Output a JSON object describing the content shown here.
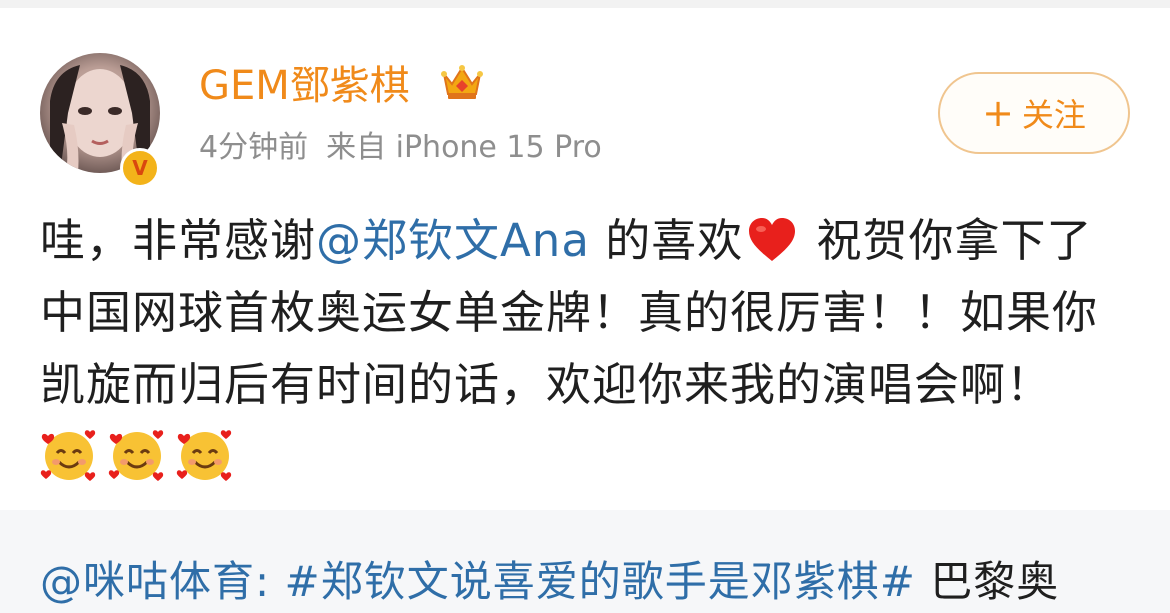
{
  "header": {
    "username": "GEM鄧紫棋",
    "time": "4分钟前",
    "source": "来自 iPhone 15 Pro",
    "follow_plus": "+",
    "follow_label": "关注",
    "icons": {
      "crown": "crown-icon",
      "verified": "verified-badge-icon"
    }
  },
  "post": {
    "seg1": "哇，非常感谢",
    "mention": "@郑钦文Ana",
    "seg2": " 的喜欢",
    "seg3": " 祝贺你拿下了中国网球首枚奥运女单金牌！真的很厉害！！如果你凯旋而归后有时间的话，欢迎你来我的演唱会啊！",
    "emojis": [
      "smiling-face-with-hearts-icon",
      "smiling-face-with-hearts-icon",
      "smiling-face-with-hearts-icon"
    ]
  },
  "quote": {
    "mention": "@咪咕体育:",
    "hashtag": " #郑钦文说喜爱的歌手是邓紫棋#",
    "text": " 巴黎奥"
  },
  "colors": {
    "username": "#f08a1a",
    "mention": "#2f6ea8",
    "meta": "#8e8e8e",
    "follow_border": "#f0c58f",
    "quote_bg": "#f6f7f9"
  }
}
